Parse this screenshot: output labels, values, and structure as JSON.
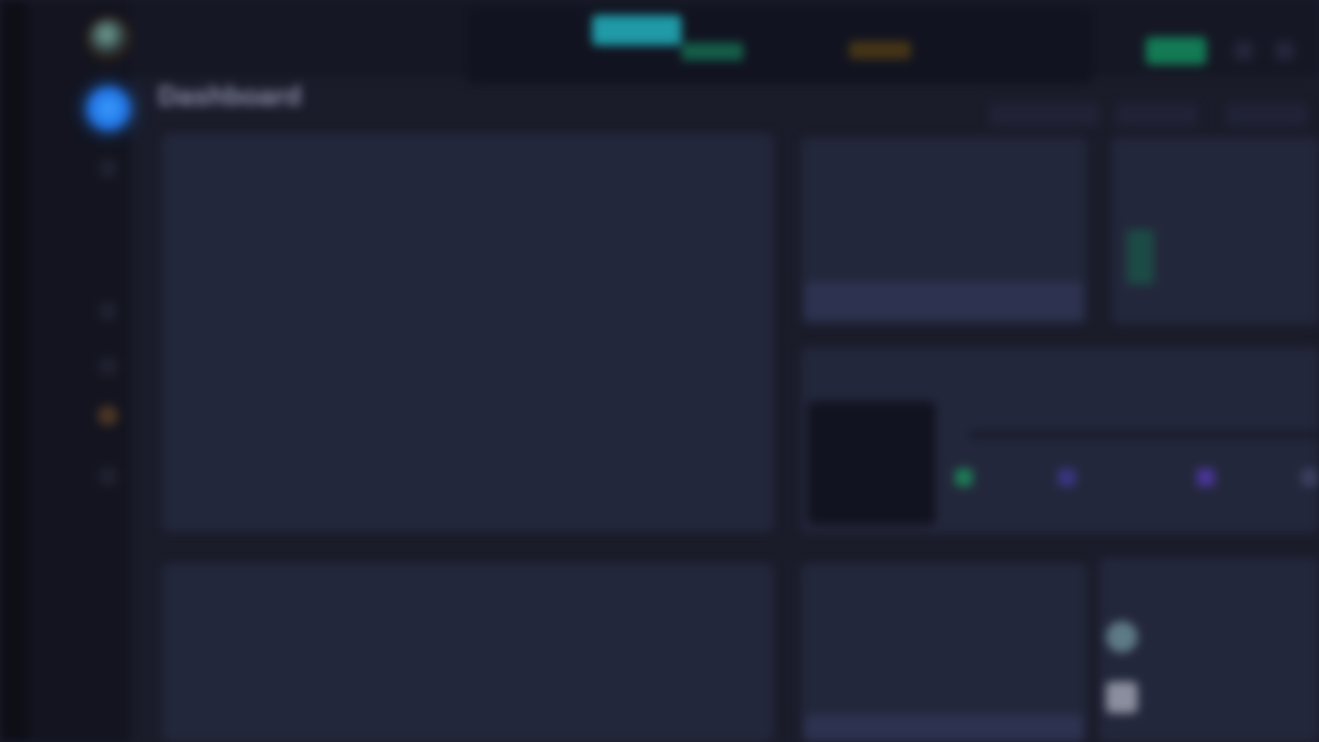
{
  "app": {
    "name": "",
    "subtitle": ""
  },
  "page": {
    "title": "Dashboard",
    "subtitle": ""
  },
  "ticker": {
    "labels": [
      "",
      "",
      "",
      "",
      "",
      ""
    ]
  },
  "filters": [
    "",
    "",
    ""
  ],
  "cards": {
    "main_chart": {
      "title": "",
      "subtitle": "",
      "link": "",
      "columns": [
        "",
        "",
        ""
      ],
      "y_ticks": [
        "",
        "",
        "",
        ""
      ],
      "x_ticks": [
        "",
        "",
        "",
        "",
        "",
        "",
        "",
        "",
        "",
        "",
        "",
        "",
        ""
      ]
    },
    "price": {
      "title": "",
      "link": "",
      "value": "",
      "strip_label": ""
    },
    "right_top": {
      "title": "",
      "link": ""
    },
    "distribution": {
      "title": "",
      "value": "",
      "stats": [
        "",
        "",
        "",
        ""
      ]
    },
    "second_chart": {
      "title": "",
      "columns": [
        "",
        "",
        ""
      ],
      "y_ticks": [
        ""
      ]
    },
    "supply": {
      "title": "",
      "value": ""
    },
    "holders": {
      "title": "",
      "rows": [
        "",
        ""
      ]
    }
  },
  "colors": {
    "accent_blue": "#2f8bff",
    "cyan": "#1f9aa6",
    "green": "#137a55",
    "gold": "#453516",
    "card_bg": "#23273b",
    "page_bg": "#1a1c2a"
  }
}
